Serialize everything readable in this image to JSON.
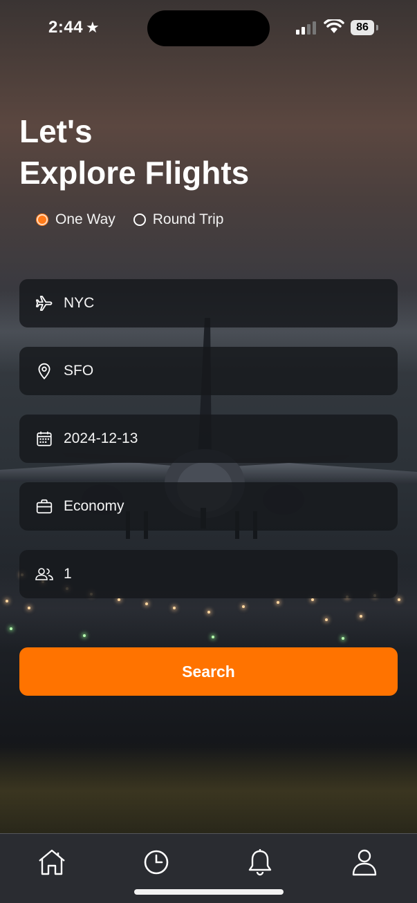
{
  "status_bar": {
    "time": "2:44",
    "battery": "86"
  },
  "header": {
    "title_line1": "Let's",
    "title_line2": "Explore Flights"
  },
  "trip_type": {
    "options": [
      {
        "label": "One Way",
        "selected": true
      },
      {
        "label": "Round Trip",
        "selected": false
      }
    ]
  },
  "form": {
    "origin": {
      "icon": "plane-icon",
      "value": "NYC"
    },
    "destination": {
      "icon": "location-pin-icon",
      "value": "SFO"
    },
    "date": {
      "icon": "calendar-icon",
      "value": "2024-12-13"
    },
    "cabin_class": {
      "icon": "briefcase-icon",
      "value": "Economy"
    },
    "passengers": {
      "icon": "people-icon",
      "value": "1"
    }
  },
  "search_button": {
    "label": "Search"
  },
  "tab_bar": {
    "items": [
      {
        "icon": "home-icon"
      },
      {
        "icon": "clock-icon"
      },
      {
        "icon": "bell-icon"
      },
      {
        "icon": "profile-icon"
      }
    ]
  },
  "colors": {
    "accent": "#ff7300",
    "field_bg": "#16181c"
  }
}
